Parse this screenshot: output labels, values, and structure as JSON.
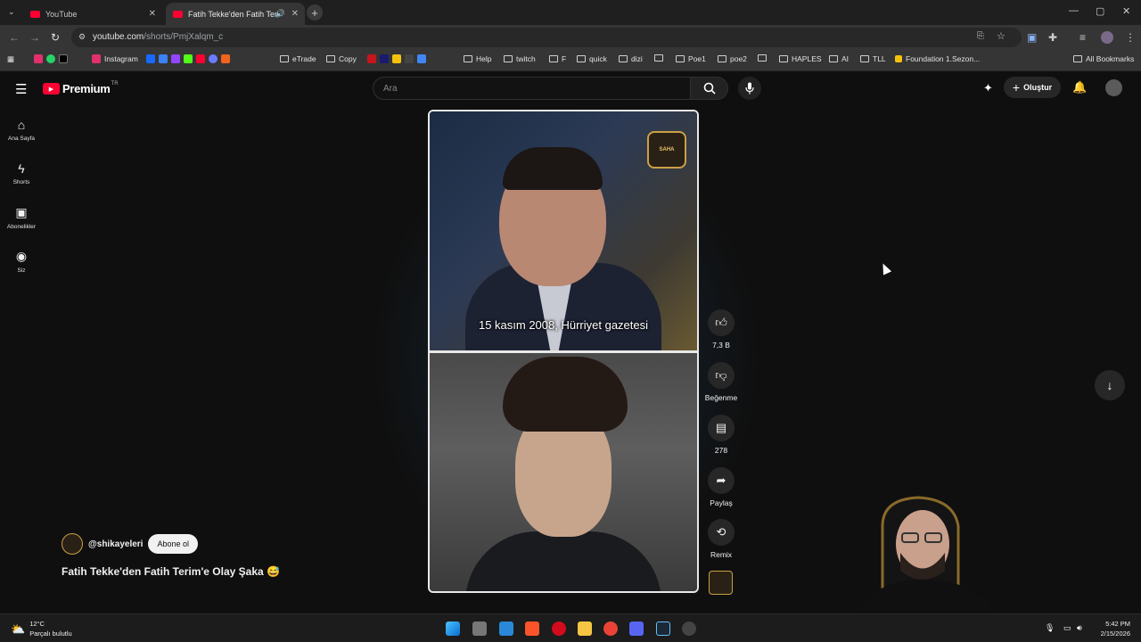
{
  "browser": {
    "tabs": [
      {
        "label": "YouTube",
        "active": false
      },
      {
        "label": "Fatih Tekke'den Fatih Terim'",
        "active": true
      }
    ],
    "url": {
      "host": "youtube.com",
      "path": "/shorts/PmjXalqm_c"
    },
    "bookmarks": [
      {
        "label": "Instagram",
        "icon": "instagram-icon",
        "color": "#e1306c"
      },
      {
        "label": "eTrade",
        "icon": "folder-icon"
      },
      {
        "label": "Copy",
        "icon": "folder-icon"
      },
      {
        "label": "Help",
        "icon": "folder-icon"
      },
      {
        "label": "twitch",
        "icon": "folder-icon"
      },
      {
        "label": "F",
        "icon": "folder-icon"
      },
      {
        "label": "quick",
        "icon": "folder-icon"
      },
      {
        "label": "dizi",
        "icon": "folder-icon"
      },
      {
        "label": "Poe1",
        "icon": "folder-icon"
      },
      {
        "label": "poe2",
        "icon": "folder-icon"
      },
      {
        "label": "HAPLES",
        "icon": "folder-icon"
      },
      {
        "label": "AI",
        "icon": "folder-icon"
      },
      {
        "label": "TLL",
        "icon": "folder-icon"
      },
      {
        "label": "Foundation 1.Sezon...",
        "icon": "page-icon"
      }
    ],
    "all_bookmarks": "All Bookmarks"
  },
  "youtube": {
    "logo": "Premium",
    "region": "TR",
    "search_placeholder": "Ara",
    "create_label": "Oluştur",
    "sidebar": [
      {
        "label": "Ana Sayfa",
        "icon": "home-icon"
      },
      {
        "label": "Shorts",
        "icon": "shorts-icon"
      },
      {
        "label": "Abonelikler",
        "icon": "subscriptions-icon"
      },
      {
        "label": "Siz",
        "icon": "user-icon"
      }
    ],
    "video": {
      "caption": "15 kasım 2008, Hürriyet gazetesi",
      "badge": "SAHA",
      "channel": "@shikayeleri",
      "subscribe": "Abone ol",
      "title": "Fatih Tekke'den Fatih Terim'e Olay Şaka 😅"
    },
    "actions": {
      "likes": "7,3 B",
      "dislike": "Beğenme",
      "comments": "278",
      "share": "Paylaş",
      "remix": "Remix"
    }
  },
  "taskbar": {
    "temperature": "12°C",
    "weather": "Parçalı bulutlu",
    "time": "5:42 PM",
    "date": "2/15/2026"
  }
}
